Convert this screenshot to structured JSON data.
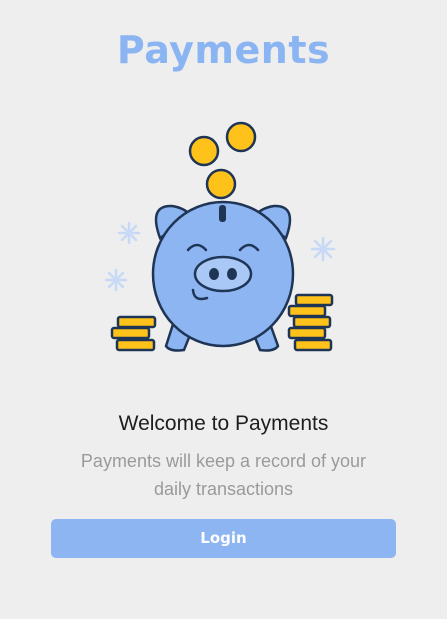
{
  "header": {
    "title": "Payments"
  },
  "illustration": {
    "icon": "piggy-bank-with-coins",
    "colors": {
      "piggy": "#8db5f2",
      "coin": "#ffc21a",
      "outline": "#1f3555",
      "sparkle": "#c7d9f6"
    }
  },
  "welcome": {
    "title": "Welcome to Payments",
    "subtitle": "Payments will keep a record of your daily transactions"
  },
  "actions": {
    "login_label": "Login"
  },
  "theme": {
    "background": "#eeeeee",
    "accent": "#8db5f2"
  }
}
